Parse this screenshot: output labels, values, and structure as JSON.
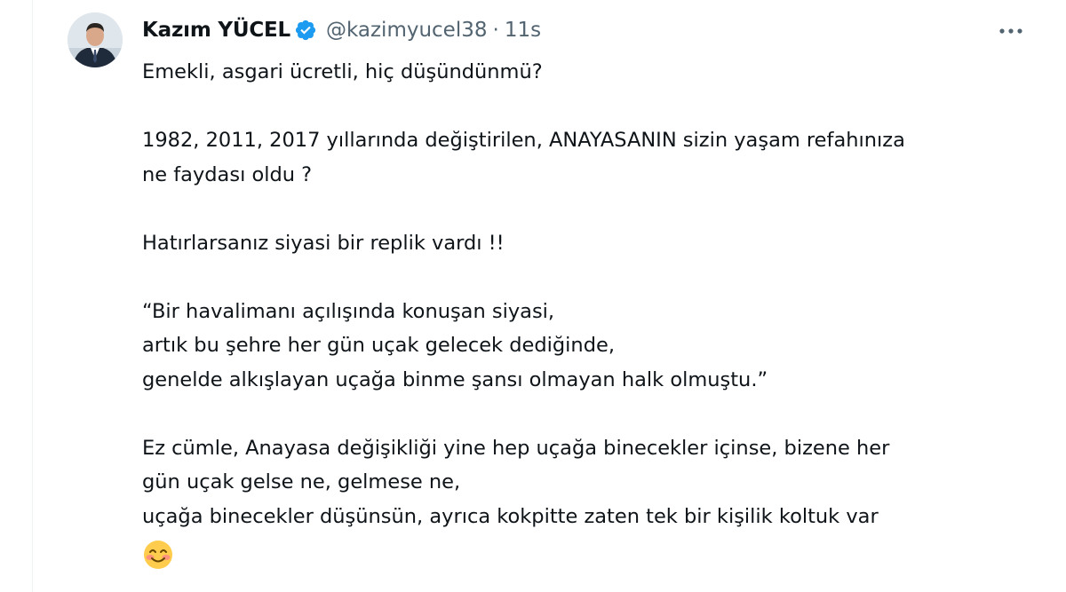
{
  "author": {
    "name": "Kazım YÜCEL",
    "handle": "@kazimyucel38",
    "separator": "·",
    "time": "11s"
  },
  "icons": {
    "verified": "verified-badge-icon",
    "more": "more-options-icon",
    "emoji": "smiling-face-with-blush-emoji"
  },
  "colors": {
    "verified": "#1d9bf0",
    "secondary_text": "#536471",
    "primary_text": "#0f1419"
  },
  "tweet": {
    "line1": "Emekli, asgari ücretli, hiç düşündünmü?",
    "line2": "1982, 2011, 2017 yıllarında değiştirilen, ANAYASANIN sizin yaşam refahınıza",
    "line3": "ne faydası oldu ?",
    "line4": "Hatırlarsanız siyasi bir replik vardı !!",
    "line5": "“Bir havalimanı açılışında konuşan siyasi,",
    "line6": "artık bu şehre her gün uçak gelecek dediğinde,",
    "line7": "genelde alkışlayan uçağa binme şansı olmayan halk olmuştu.”",
    "line8": "Ez cümle, Anayasa değişikliği yine hep uçağa binecekler içinse, bizene her",
    "line9": "gün uçak gelse ne, gelmese ne,",
    "line10": "uçağa binecekler düşünsün, ayrıca kokpitte zaten tek bir kişilik koltuk var"
  }
}
